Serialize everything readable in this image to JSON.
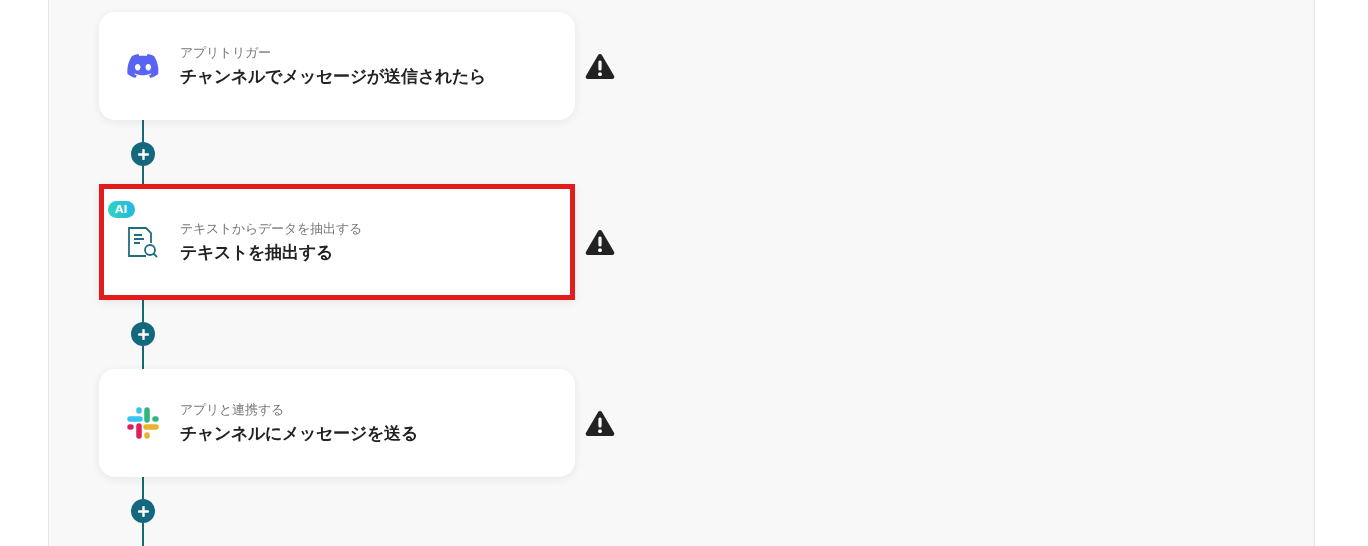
{
  "steps": [
    {
      "kind": "discord",
      "label": "アプリトリガー",
      "title": "チャンネルでメッセージが送信されたら",
      "highlighted": false,
      "warning": true
    },
    {
      "kind": "ai-extract",
      "badge": "AI",
      "label": "テキストからデータを抽出する",
      "title": "テキストを抽出する",
      "highlighted": true,
      "warning": true
    },
    {
      "kind": "slack",
      "label": "アプリと連携する",
      "title": "チャンネルにメッセージを送る",
      "highlighted": false,
      "warning": true
    }
  ]
}
